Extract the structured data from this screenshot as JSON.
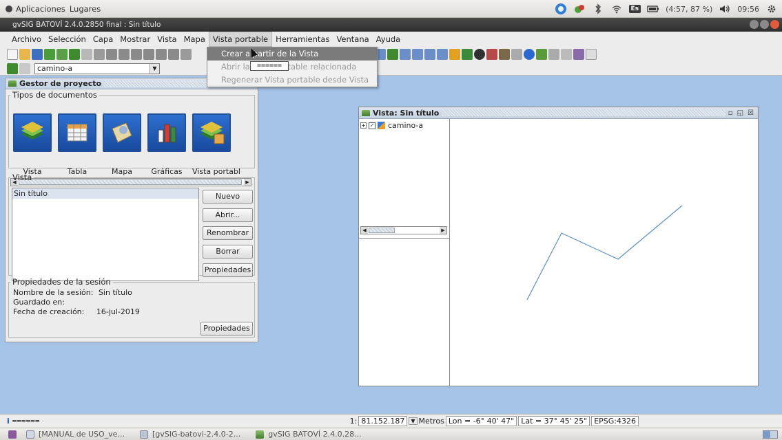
{
  "system_panel": {
    "apps_label": "Aplicaciones",
    "places_label": "Lugares",
    "battery": "(4:57, 87 %)",
    "time": "09:56",
    "keyboard": "Es"
  },
  "window": {
    "title": "gvSIG BATOVÍ 2.4.0.2850 final : Sin título"
  },
  "menubar": {
    "items": [
      {
        "label": "Archivo"
      },
      {
        "label": "Selección"
      },
      {
        "label": "Capa"
      },
      {
        "label": "Mostrar"
      },
      {
        "label": "Vista"
      },
      {
        "label": "Mapa"
      },
      {
        "label": "Vista portable"
      },
      {
        "label": "Herramientas"
      },
      {
        "label": "Ventana"
      },
      {
        "label": "Ayuda"
      }
    ]
  },
  "toolbar": {
    "layer_combo_value": "camino-a"
  },
  "dropdown": {
    "items": [
      {
        "label": "Crear a partir de la Vista"
      },
      {
        "label": "Abrir la Vista portable relacionada"
      },
      {
        "label": "Regenerar Vista portable desde Vista"
      }
    ],
    "tooltip": "======"
  },
  "project_manager": {
    "title": "Gestor de proyecto",
    "doc_types_legend": "Tipos de documentos",
    "doc_types": [
      {
        "label": "Vista"
      },
      {
        "label": "Tabla"
      },
      {
        "label": "Mapa"
      },
      {
        "label": "Gráficas"
      },
      {
        "label": "Vista portabl"
      }
    ],
    "list_legend": "Vista",
    "list_items": [
      "Sin título"
    ],
    "buttons": {
      "new": "Nuevo",
      "open": "Abrir...",
      "rename": "Renombrar",
      "delete": "Borrar",
      "properties": "Propiedades"
    },
    "session": {
      "legend": "Propiedades de la sesión",
      "name_label": "Nombre de la sesión:",
      "name_value": "Sin título",
      "saved_label": "Guardado en:",
      "created_label": "Fecha de creación:",
      "created_value": "16-jul-2019",
      "properties_button": "Propiedades"
    }
  },
  "view_window": {
    "title": "Vista: Sin título",
    "layer_name": "camino-a"
  },
  "statusbar": {
    "message": "======",
    "scale_prefix": "1:",
    "scale": "81.152.187",
    "units": "Metros",
    "lon": "Lon = -6° 40' 47\"",
    "lat": "Lat = 37° 45' 25\"",
    "crs": "EPSG:4326"
  },
  "taskbar": {
    "items": [
      {
        "label": "[MANUAL de USO_ve..."
      },
      {
        "label": "[gvSIG-batovi-2.4.0-2..."
      },
      {
        "label": "gvSIG BATOVÍ 2.4.0.28..."
      }
    ]
  }
}
